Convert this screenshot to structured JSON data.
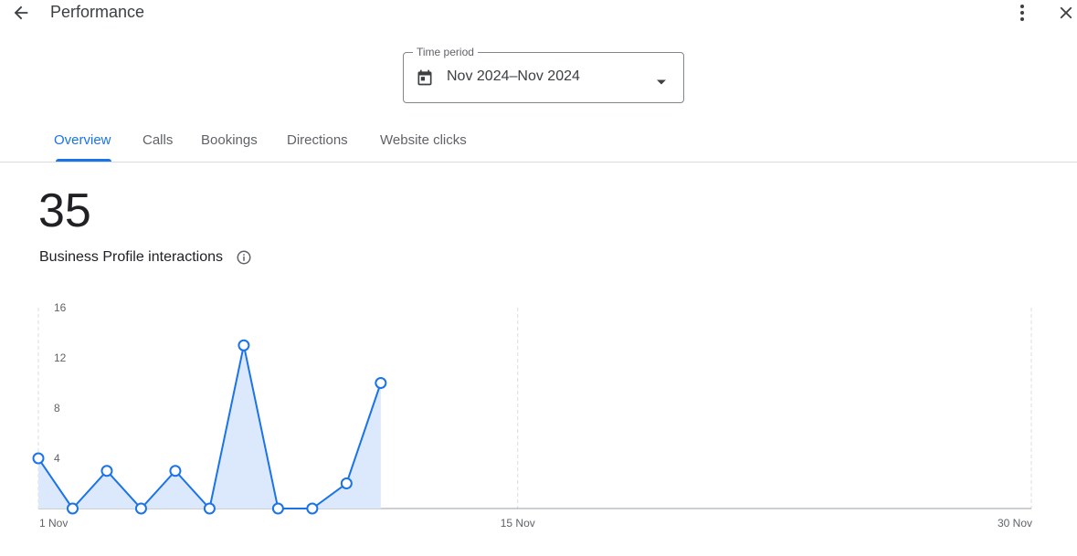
{
  "header": {
    "title": "Performance",
    "back_icon": "arrow-back-icon",
    "more_icon": "more-vert-icon",
    "close_icon": "close-icon"
  },
  "time_period": {
    "label": "Time period",
    "value": "Nov 2024–Nov 2024",
    "icon": "calendar-icon"
  },
  "tabs": [
    {
      "label": "Overview",
      "active": true
    },
    {
      "label": "Calls",
      "active": false
    },
    {
      "label": "Bookings",
      "active": false
    },
    {
      "label": "Directions",
      "active": false
    },
    {
      "label": "Website clicks",
      "active": false
    }
  ],
  "metric": {
    "value": "35",
    "label": "Business Profile interactions"
  },
  "colors": {
    "accent": "#1a73e8",
    "area_fill": "#dce8fb"
  },
  "chart_data": {
    "type": "area",
    "ylim": [
      0,
      16
    ],
    "yticks": [
      "16",
      "12",
      "8",
      "4"
    ],
    "xtick_labels": [
      "1 Nov",
      "15 Nov",
      "30 Nov"
    ],
    "xtick_days": [
      1,
      15,
      30
    ],
    "xlim": [
      1,
      30
    ],
    "series": [
      {
        "x": [
          1,
          2,
          3,
          4,
          5,
          6,
          7,
          8,
          9,
          10,
          11
        ],
        "values": [
          4,
          0,
          3,
          0,
          3,
          0,
          13,
          0,
          0,
          2,
          10
        ]
      }
    ]
  }
}
